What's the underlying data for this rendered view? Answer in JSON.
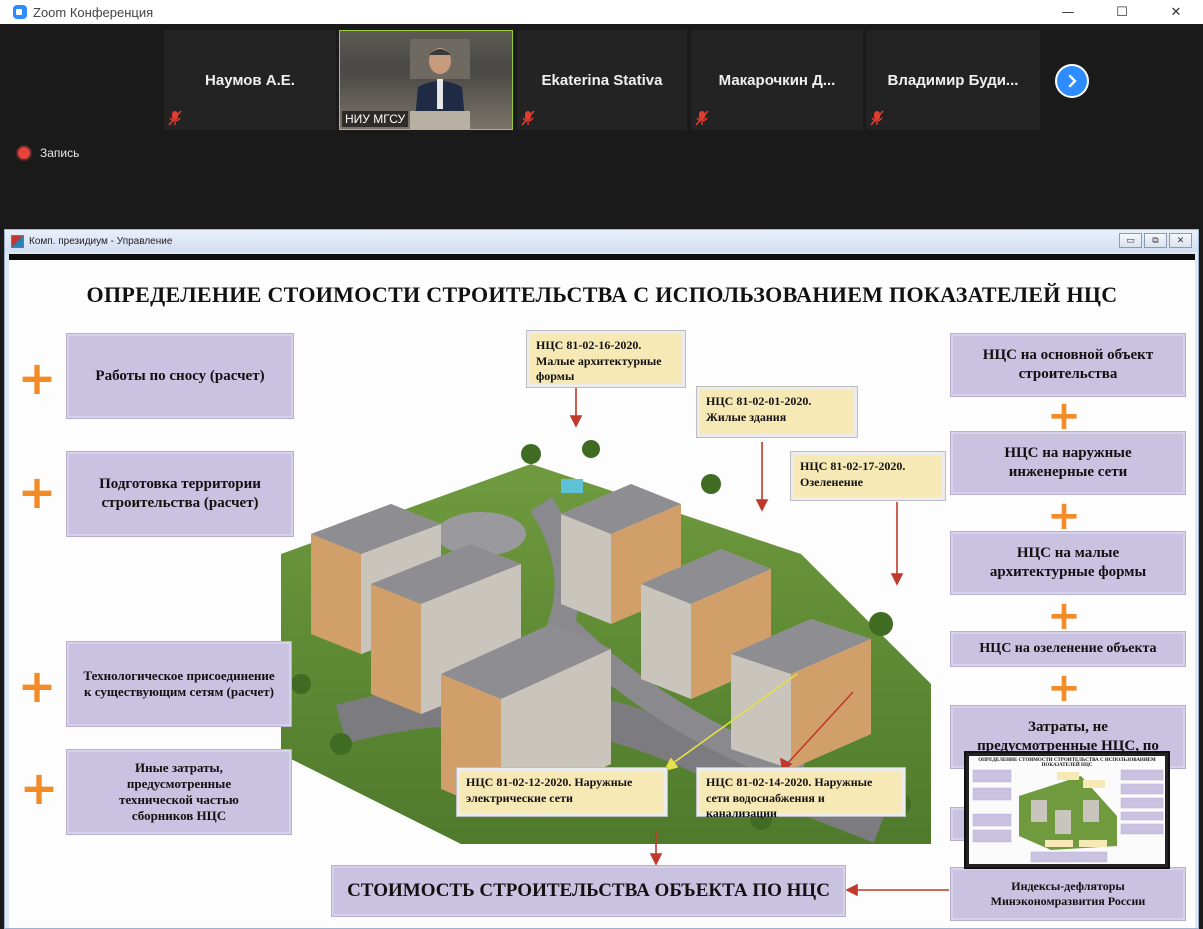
{
  "zoom": {
    "window_title": "Zoom Конференция",
    "window_controls": [
      "—",
      "☐",
      "✕"
    ],
    "participants": [
      {
        "name": "Наумов А.Е.",
        "muted": true
      },
      {
        "name": "НИУ МГСУ",
        "video": true
      },
      {
        "name": "Ekaterina Stativa",
        "muted": true
      },
      {
        "name": "Макарочкин    Д...",
        "muted": true
      },
      {
        "name": "Владимир   Буди...",
        "muted": true
      }
    ],
    "recording_label": "Запись",
    "accent_color": "#2d8cff"
  },
  "shared_window": {
    "title": "Комп. президиум - Управление",
    "controls": [
      "▭",
      "⧉",
      "✕"
    ]
  },
  "slide": {
    "title": "ОПРЕДЕЛЕНИЕ СТОИМОСТИ СТРОИТЕЛЬСТВА С ИСПОЛЬЗОВАНИЕМ ПОКАЗАТЕЛЕЙ НЦС",
    "plus_symbol": "+",
    "left_boxes": [
      "Работы по сносу (расчет)",
      "Подготовка территории строительства (расчет)",
      "Технологическое присоединение к существующим сетям (расчет)",
      "Иные затраты, предусмотренные технической частью сборников НЦС"
    ],
    "right_boxes": [
      "НЦС на основной объект строительства",
      "НЦС на наружные инженерные сети",
      "НЦС на малые архитектурные формы",
      "НЦС на озеленение объекта",
      "Затраты, не предусмотренные НЦС, по"
    ],
    "callouts": [
      "НЦС 81-02-16-2020. Малые архитектурные формы",
      "НЦС 81-02-01-2020. Жилые здания",
      "НЦС 81-02-17-2020. Озеленение",
      "НЦС 81-02-12-2020. Наружные электрические сети",
      "НЦС 81-02-14-2020. Наружные сети водоснабжения и канализации"
    ],
    "result": "СТОИМОСТЬ СТРОИТЕЛЬСТВА ОБЪЕКТА ПО НЦС",
    "deflators": "Индексы-дефляторы Минэкономразвития России",
    "accent_plus_color": "#f28c28",
    "box_color": "#c9c2e0",
    "callout_color": "#f7e9b6",
    "arrow_color": "#c0392b"
  },
  "thumbnail": {
    "title": "ОПРЕДЕЛЕНИЕ СТОИМОСТИ СТРОИТЕЛЬСТВА С ИСПОЛЬЗОВАНИЕМ ПОКАЗАТЕЛЕЙ НЦС"
  }
}
